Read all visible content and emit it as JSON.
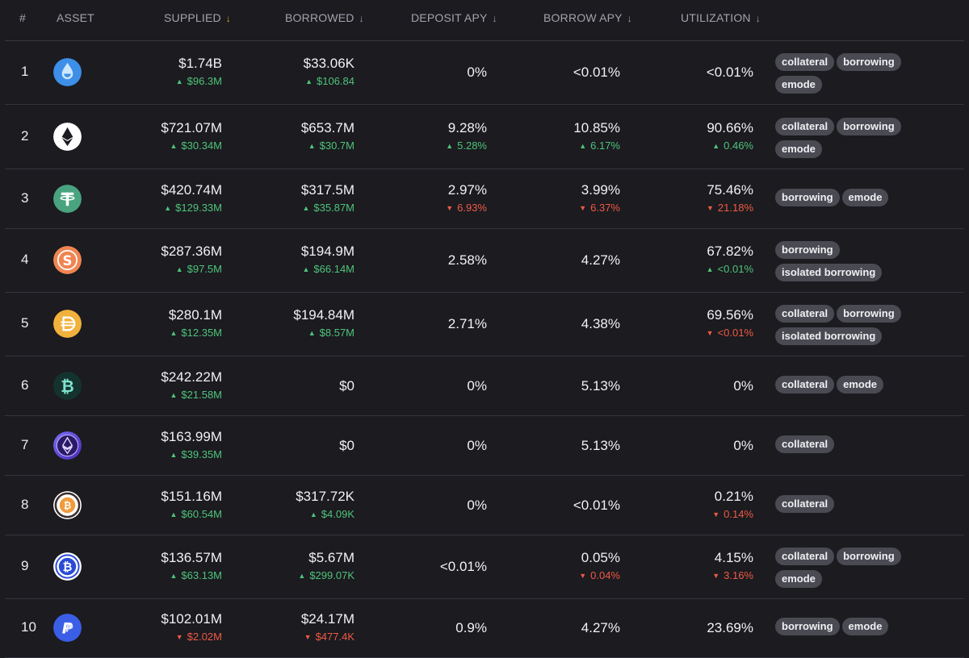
{
  "headers": {
    "idx": "#",
    "asset": "ASSET",
    "supplied": "SUPPLIED",
    "borrowed": "BORROWED",
    "deposit_apy": "DEPOSIT APY",
    "borrow_apy": "BORROW APY",
    "utilization": "UTILIZATION",
    "sort_arrow": "↓"
  },
  "colors": {
    "background": "#1b1b20",
    "up": "#4fc47a",
    "down": "#f05a44",
    "active_sort": "#f0a830",
    "badge": "#4a4a53"
  },
  "rows": [
    {
      "idx": "1",
      "icon": "liquid-staking-drop-icon",
      "supplied": {
        "main": "$1.74B",
        "delta": "$96.3M",
        "dir": "up"
      },
      "borrowed": {
        "main": "$33.06K",
        "delta": "$106.84",
        "dir": "up"
      },
      "deposit": {
        "main": "0%"
      },
      "borrow": {
        "main": "<0.01%"
      },
      "util": {
        "main": "<0.01%"
      },
      "badges": [
        "collateral",
        "borrowing",
        "emode"
      ]
    },
    {
      "idx": "2",
      "icon": "ethereum-icon",
      "supplied": {
        "main": "$721.07M",
        "delta": "$30.34M",
        "dir": "up"
      },
      "borrowed": {
        "main": "$653.7M",
        "delta": "$30.7M",
        "dir": "up"
      },
      "deposit": {
        "main": "9.28%",
        "delta": "5.28%",
        "dir": "up"
      },
      "borrow": {
        "main": "10.85%",
        "delta": "6.17%",
        "dir": "up"
      },
      "util": {
        "main": "90.66%",
        "delta": "0.46%",
        "dir": "up"
      },
      "badges": [
        "collateral",
        "borrowing",
        "emode"
      ]
    },
    {
      "idx": "3",
      "icon": "tether-icon",
      "supplied": {
        "main": "$420.74M",
        "delta": "$129.33M",
        "dir": "up"
      },
      "borrowed": {
        "main": "$317.5M",
        "delta": "$35.87M",
        "dir": "up"
      },
      "deposit": {
        "main": "2.97%",
        "delta": "6.93%",
        "dir": "down"
      },
      "borrow": {
        "main": "3.99%",
        "delta": "6.37%",
        "dir": "down"
      },
      "util": {
        "main": "75.46%",
        "delta": "21.18%",
        "dir": "down"
      },
      "badges": [
        "borrowing",
        "emode"
      ]
    },
    {
      "idx": "4",
      "icon": "sky-usds-icon",
      "supplied": {
        "main": "$287.36M",
        "delta": "$97.5M",
        "dir": "up"
      },
      "borrowed": {
        "main": "$194.9M",
        "delta": "$66.14M",
        "dir": "up"
      },
      "deposit": {
        "main": "2.58%"
      },
      "borrow": {
        "main": "4.27%"
      },
      "util": {
        "main": "67.82%",
        "delta": "<0.01%",
        "dir": "up"
      },
      "badges": [
        "borrowing",
        "isolated borrowing"
      ]
    },
    {
      "idx": "5",
      "icon": "dai-icon",
      "supplied": {
        "main": "$280.1M",
        "delta": "$12.35M",
        "dir": "up"
      },
      "borrowed": {
        "main": "$194.84M",
        "delta": "$8.57M",
        "dir": "up"
      },
      "deposit": {
        "main": "2.71%"
      },
      "borrow": {
        "main": "4.38%"
      },
      "util": {
        "main": "69.56%",
        "delta": "<0.01%",
        "dir": "down"
      },
      "badges": [
        "collateral",
        "borrowing",
        "isolated borrowing"
      ]
    },
    {
      "idx": "6",
      "icon": "bitcoin-teal-icon",
      "supplied": {
        "main": "$242.22M",
        "delta": "$21.58M",
        "dir": "up"
      },
      "borrowed": {
        "main": "$0"
      },
      "deposit": {
        "main": "0%"
      },
      "borrow": {
        "main": "5.13%"
      },
      "util": {
        "main": "0%"
      },
      "badges": [
        "collateral",
        "emode"
      ]
    },
    {
      "idx": "7",
      "icon": "ethereum-restaked-icon",
      "supplied": {
        "main": "$163.99M",
        "delta": "$39.35M",
        "dir": "up"
      },
      "borrowed": {
        "main": "$0"
      },
      "deposit": {
        "main": "0%"
      },
      "borrow": {
        "main": "5.13%"
      },
      "util": {
        "main": "0%"
      },
      "badges": [
        "collateral"
      ]
    },
    {
      "idx": "8",
      "icon": "bitcoin-orange-icon",
      "supplied": {
        "main": "$151.16M",
        "delta": "$60.54M",
        "dir": "up"
      },
      "borrowed": {
        "main": "$317.72K",
        "delta": "$4.09K",
        "dir": "up"
      },
      "deposit": {
        "main": "0%"
      },
      "borrow": {
        "main": "<0.01%"
      },
      "util": {
        "main": "0.21%",
        "delta": "0.14%",
        "dir": "down"
      },
      "badges": [
        "collateral"
      ]
    },
    {
      "idx": "9",
      "icon": "wrapped-bitcoin-icon",
      "supplied": {
        "main": "$136.57M",
        "delta": "$63.13M",
        "dir": "up"
      },
      "borrowed": {
        "main": "$5.67M",
        "delta": "$299.07K",
        "dir": "up"
      },
      "deposit": {
        "main": "<0.01%"
      },
      "borrow": {
        "main": "0.05%",
        "delta": "0.04%",
        "dir": "down"
      },
      "util": {
        "main": "4.15%",
        "delta": "3.16%",
        "dir": "down"
      },
      "badges": [
        "collateral",
        "borrowing",
        "emode"
      ]
    },
    {
      "idx": "10",
      "icon": "paypal-usd-icon",
      "supplied": {
        "main": "$102.01M",
        "delta": "$2.02M",
        "dir": "down"
      },
      "borrowed": {
        "main": "$24.17M",
        "delta": "$477.4K",
        "dir": "down"
      },
      "deposit": {
        "main": "0.9%"
      },
      "borrow": {
        "main": "4.27%"
      },
      "util": {
        "main": "23.69%"
      },
      "badges": [
        "borrowing",
        "emode"
      ]
    }
  ]
}
